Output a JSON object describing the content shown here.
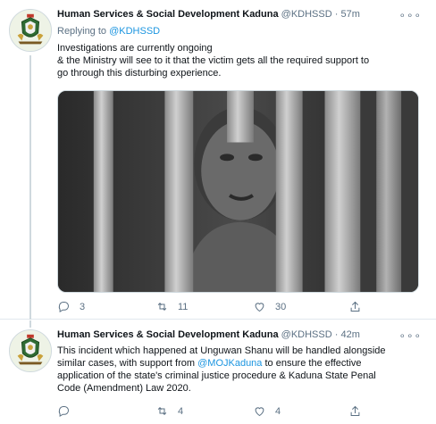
{
  "tweets": [
    {
      "name": "Human Services & Social Development Kaduna",
      "handle": "@KDHSSD",
      "separator": "·",
      "time": "57m",
      "more": "∘∘∘",
      "replying_prefix": "Replying to",
      "replying_to": "@KDHSSD",
      "lines": [
        "Investigations are currently ongoing",
        "& the Ministry will see to it that the victim gets all the required support to",
        "go through this disturbing experience."
      ],
      "stats": {
        "replies": "3",
        "retweets": "11",
        "likes": "30"
      }
    },
    {
      "name": "Human Services & Social Development Kaduna",
      "handle": "@KDHSSD",
      "separator": "·",
      "time": "42m",
      "more": "∘∘∘",
      "line1": "This incident which happened at Unguwan Shanu will be handled alongside",
      "line2_before": "similar cases, with support from ",
      "line2_mention": "@MOJKaduna",
      "line2_after": " to ensure the effective",
      "line3": "application of the state's criminal justice procedure & Kaduna State Penal",
      "line4": "Code (Amendment) Law 2020.",
      "stats": {
        "replies": "",
        "retweets": "4",
        "likes": "4"
      }
    }
  ],
  "icons": {
    "avatar": "kaduna-state-crest",
    "reply": "reply-icon",
    "retweet": "retweet-icon",
    "like": "heart-icon",
    "share": "share-icon"
  },
  "colors": {
    "link": "#1b95e0",
    "muted": "#5b7083",
    "text": "#0f1419",
    "border": "#e1e8ed"
  }
}
